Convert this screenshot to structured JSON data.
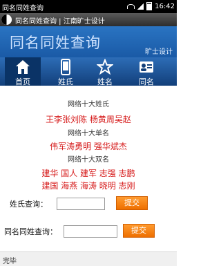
{
  "status_bar": {
    "title": "同名同姓查询",
    "time": "16:42"
  },
  "app_bar": {
    "title": "同名同姓查询 | 江南旷士设计"
  },
  "banner": {
    "title": "同名同姓查询",
    "subtitle": "旷士设计"
  },
  "nav": {
    "items": [
      {
        "label": "首页",
        "icon": "home-icon"
      },
      {
        "label": "姓氏",
        "icon": "phone-icon"
      },
      {
        "label": "姓名",
        "icon": "star-icon"
      },
      {
        "label": "同名",
        "icon": "contact-card-icon"
      }
    ]
  },
  "lists": {
    "surnames_heading": "网络十大姓氏",
    "surnames_value": "王李张刘陈 杨黄周吴赵",
    "single_names_heading": "网络十大单名",
    "single_names_value": "伟军涛勇明 强华斌杰",
    "double_names_heading": "网络十大双名",
    "double_names_line1": "建华 国人 建军 志强 志鹏",
    "double_names_line2": "建国 海燕 海涛 晓明 志刚"
  },
  "forms": {
    "surname_label": "姓氏查询：",
    "surname_value": "",
    "surname_button": "提交",
    "fullname_label": "同名同姓查询：",
    "fullname_value": "",
    "fullname_button": "提交"
  },
  "footer": {
    "status": "完毕"
  },
  "colors": {
    "banner_bg": "#1f65b3",
    "nav_active": "#0a3366",
    "accent_red": "#d61a1a",
    "button_orange": "#f58518"
  }
}
